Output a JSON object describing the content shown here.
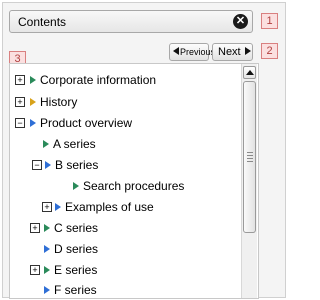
{
  "panel": {
    "title": "Contents",
    "close_glyph": "✕"
  },
  "markers": [
    "1",
    "2",
    "3"
  ],
  "nav": {
    "previous_label": "Previous",
    "next_label": "Next"
  },
  "tree": {
    "items": [
      {
        "label": "Corporate information",
        "toggle": "+",
        "bullet_color": "#2a8a5a"
      },
      {
        "label": "History",
        "toggle": "+",
        "bullet_color": "#d8a21a"
      },
      {
        "label": "Product overview",
        "toggle": "−",
        "bullet_color": "#2f6fd6"
      },
      {
        "label": "A series",
        "toggle": "",
        "bullet_color": "#2a8a5a"
      },
      {
        "label": "B series",
        "toggle": "−",
        "bullet_color": "#2f6fd6"
      },
      {
        "label": "Search procedures",
        "toggle": "",
        "bullet_color": "#2a8a5a"
      },
      {
        "label": "Examples of use",
        "toggle": "+",
        "bullet_color": "#2f6fd6"
      },
      {
        "label": "C series",
        "toggle": "+",
        "bullet_color": "#2a8a5a"
      },
      {
        "label": "D series",
        "toggle": "",
        "bullet_color": "#2f6fd6"
      },
      {
        "label": "E series",
        "toggle": "+",
        "bullet_color": "#2a8a5a"
      },
      {
        "label": "F series",
        "toggle": "",
        "bullet_color": "#2f6fd6"
      }
    ]
  }
}
